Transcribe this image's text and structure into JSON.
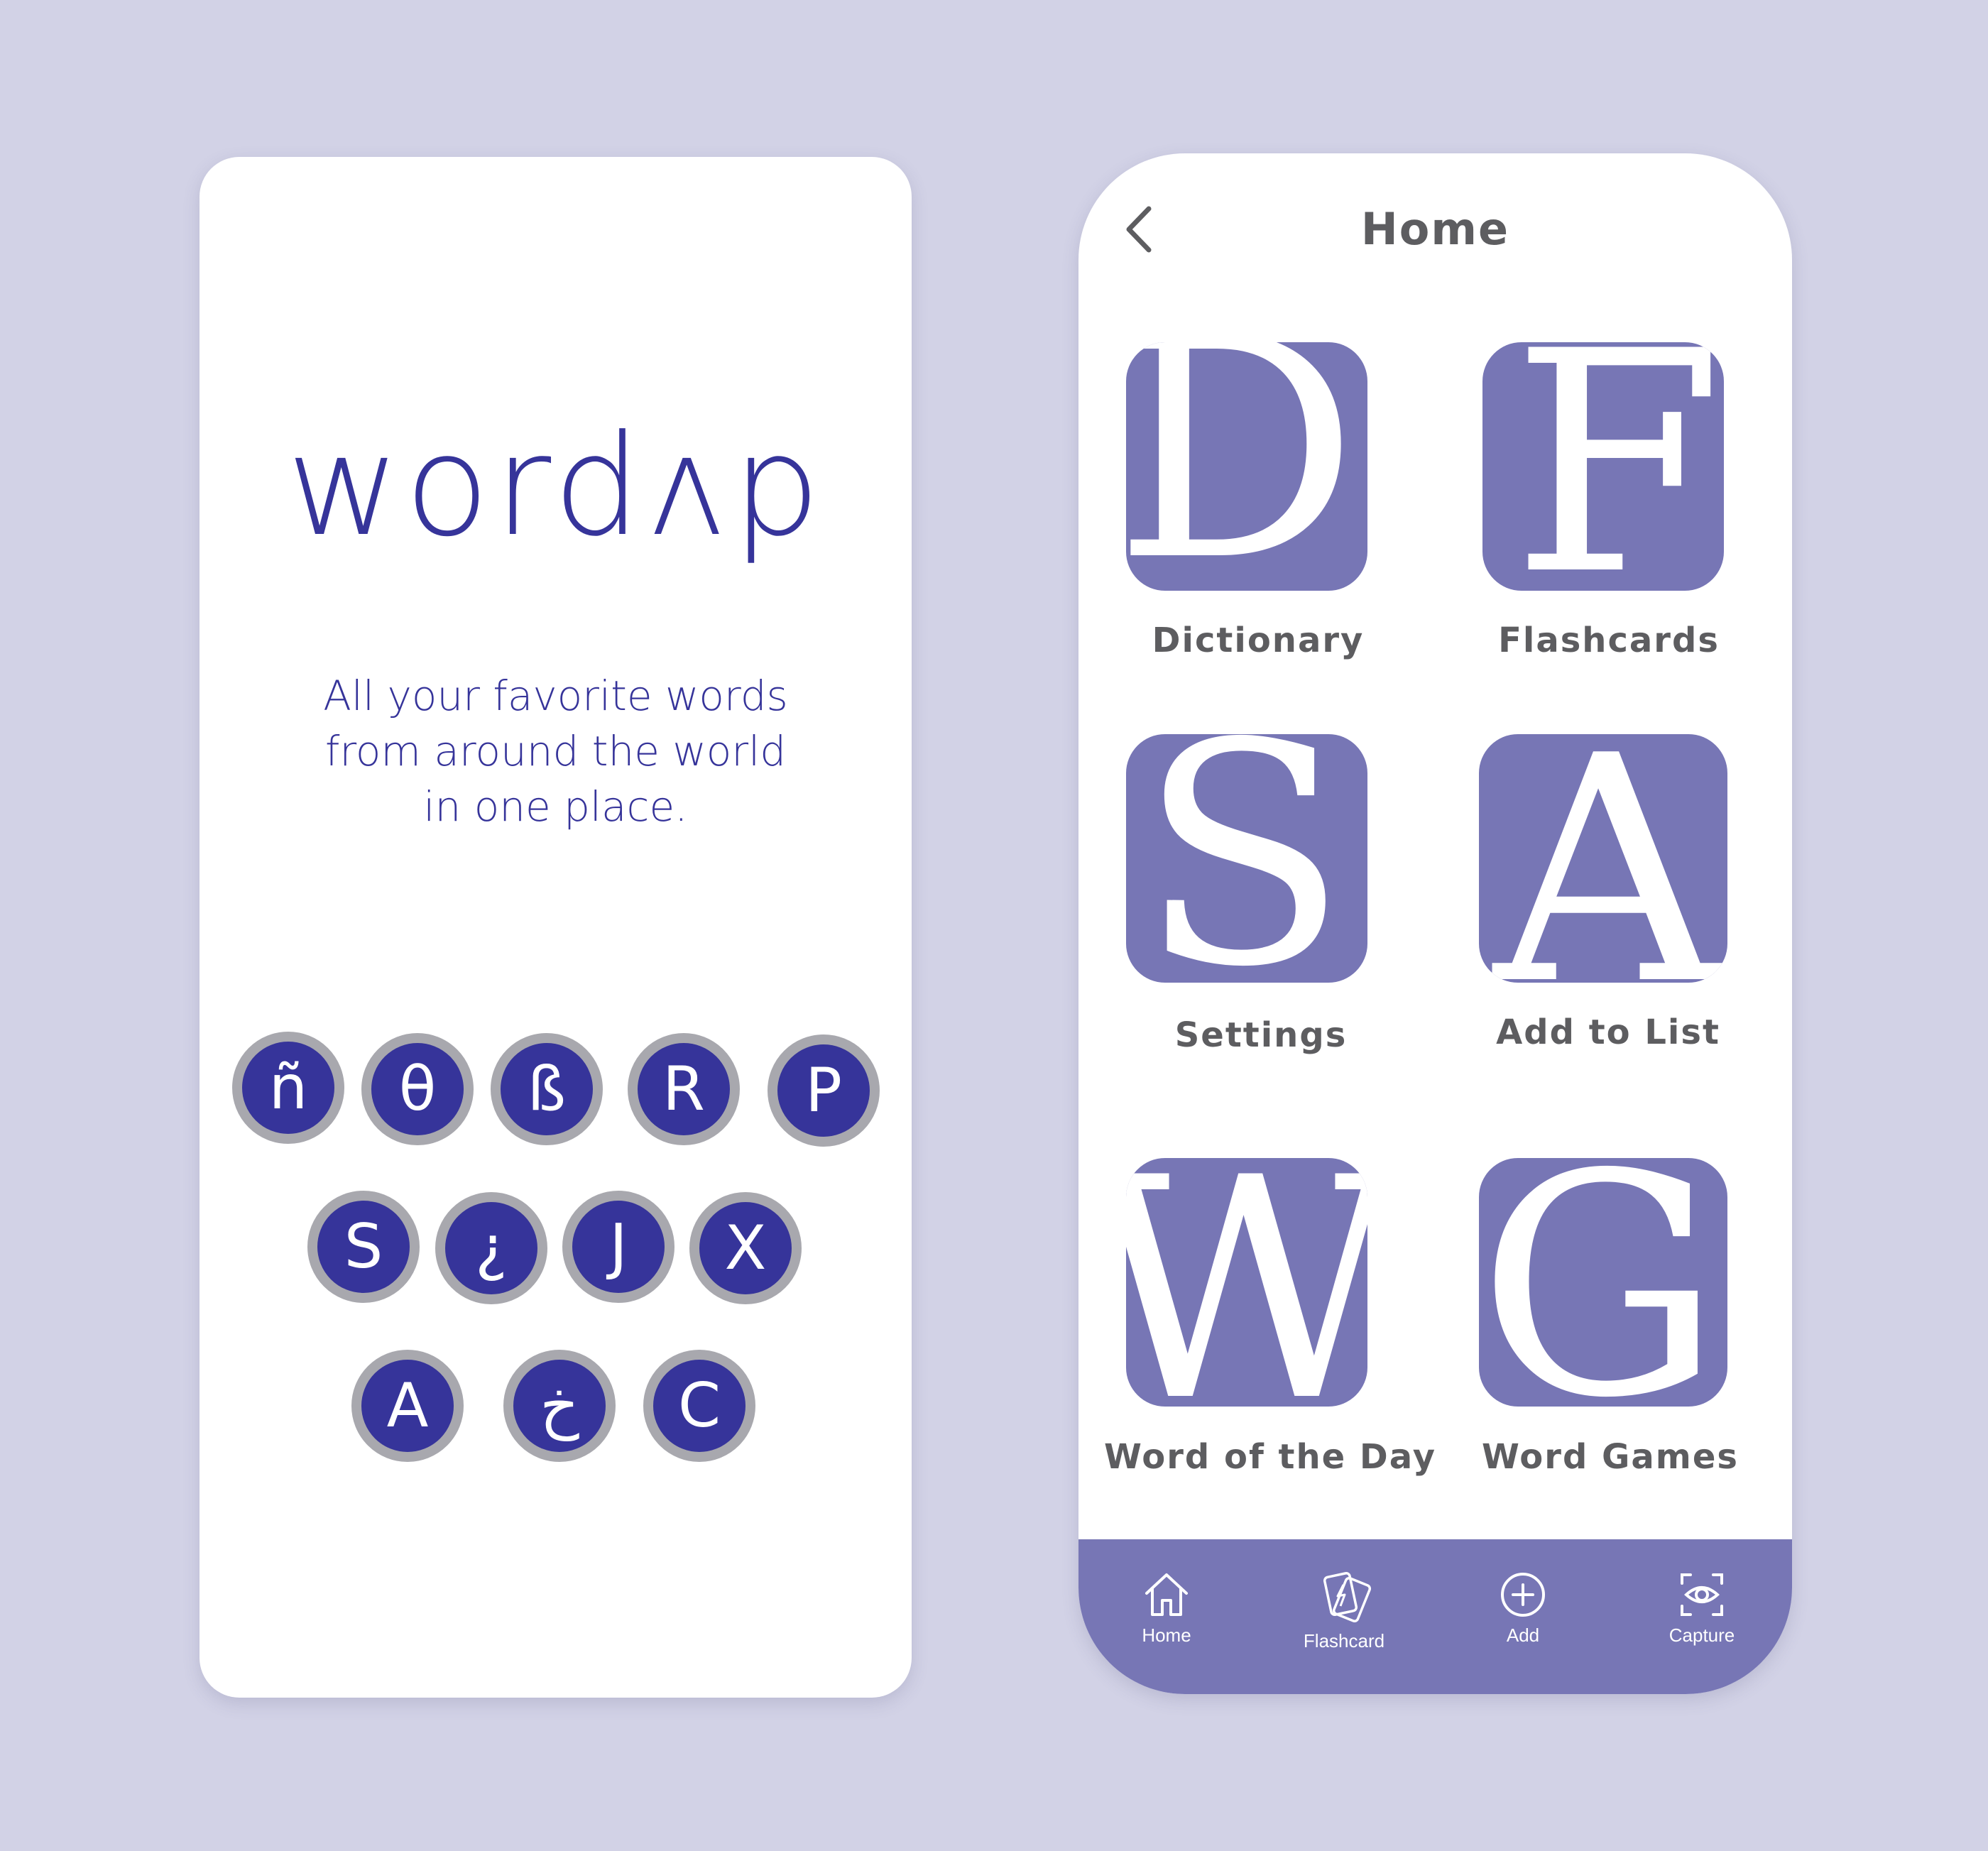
{
  "colors": {
    "background": "#d2d2e6",
    "brand_indigo": "#36349a",
    "tile_purple": "#7776b5",
    "chip_ring_gray": "#a8a8ae",
    "label_gray": "#5d5d60"
  },
  "splash": {
    "logo": "wordʌp",
    "tagline": [
      "All your favorite words",
      "from around the world",
      "in one place."
    ],
    "letters": [
      "ñ",
      "θ",
      "ß",
      "R",
      "P",
      "S",
      "¿",
      "J",
      "X",
      "A",
      "خ",
      "C"
    ]
  },
  "home": {
    "back_icon": "chevron-left-icon",
    "title": "Home",
    "tiles": [
      {
        "letter": "D",
        "label": "Dictionary"
      },
      {
        "letter": "F",
        "label": "Flashcards"
      },
      {
        "letter": "S",
        "label": "Settings"
      },
      {
        "letter": "A",
        "label": "Add to List"
      },
      {
        "letter": "W",
        "label": "Word of the Day"
      },
      {
        "letter": "G",
        "label": "Word Games"
      }
    ],
    "nav": [
      {
        "label": "Home",
        "icon": "home-icon"
      },
      {
        "label": "Flashcard",
        "icon": "flashcard-icon"
      },
      {
        "label": "Add",
        "icon": "add-circle-icon"
      },
      {
        "label": "Capture",
        "icon": "capture-eye-icon"
      }
    ]
  }
}
